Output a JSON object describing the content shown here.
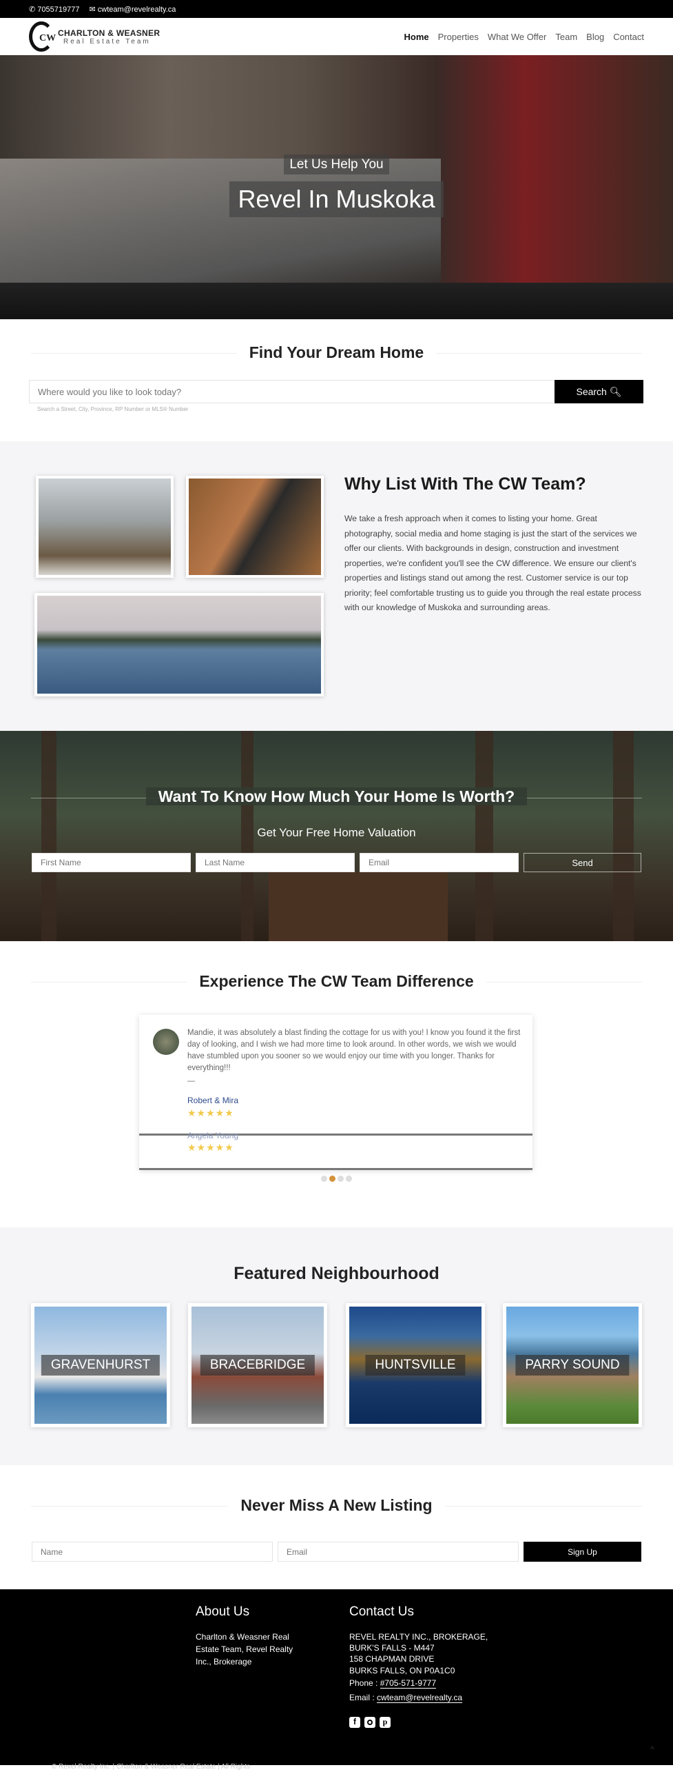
{
  "topbar": {
    "phone": "7055719777",
    "email": "cwteam@revelrealty.ca",
    "phone_icon": "phone-icon",
    "email_icon": "envelope-icon"
  },
  "nav": {
    "logo": {
      "mark": "CW",
      "name": "CHARLTON & WEASNER",
      "tagline": "Real Estate Team"
    },
    "items": [
      {
        "label": "Home"
      },
      {
        "label": "Properties"
      },
      {
        "label": "What We Offer"
      },
      {
        "label": "Team"
      },
      {
        "label": "Blog"
      },
      {
        "label": "Contact"
      }
    ]
  },
  "hero": {
    "subtitle": "Let Us Help You",
    "title": "Revel In Muskoka"
  },
  "search": {
    "title": "Find Your Dream Home",
    "placeholder": "Where would you like to look today?",
    "button": "Search",
    "hint": "Search a Street, City, Province, RP Number or MLS® Number"
  },
  "why": {
    "title": "Why List With The CW Team?",
    "body": "We take a fresh approach when it comes to listing your home. Great photography, social media and home staging is just the start of the services we offer our clients. With backgrounds in design, construction and investment properties, we're confident you'll see the CW difference. We ensure our client's properties and listings stand out among the rest. Customer service is our top priority; feel comfortable trusting us to guide you through the real estate process with our knowledge of Muskoka and surrounding areas."
  },
  "valuation": {
    "title": "Want To Know How Much Your Home Is Worth?",
    "subtitle": "Get Your Free Home Valuation",
    "first_placeholder": "First Name",
    "last_placeholder": "Last Name",
    "email_placeholder": "Email",
    "button": "Send"
  },
  "testimonials": {
    "title": "Experience The CW Team Difference",
    "items": [
      {
        "quote": "Mandie, it was absolutely a blast finding the cottage for us with you! I know you found it the first day of looking, and I wish we had more time to look around. In other words, we wish we would have stumbled upon you sooner so we would enjoy our time with you longer. Thanks for everything!!!",
        "dash": "—",
        "author": "Robert & Mira",
        "stars": "★★★★★",
        "rating": 5
      },
      {
        "author": "Angela Young",
        "stars": "★★★★★",
        "rating": 5
      }
    ],
    "dots": 4,
    "active_dot": 2,
    "accent": "#d4923a",
    "name_color": "#2d4a8a"
  },
  "featured": {
    "title": "Featured Neighbourhood",
    "items": [
      {
        "label": "GRAVENHURST"
      },
      {
        "label": "BRACEBRIDGE"
      },
      {
        "label": "HUNTSVILLE"
      },
      {
        "label": "PARRY SOUND"
      }
    ]
  },
  "newsletter": {
    "title": "Never Miss A New Listing",
    "name_placeholder": "Name",
    "email_placeholder": "Email",
    "button": "Sign Up"
  },
  "footer": {
    "about_title": "About Us",
    "about_text": "Charlton & Weasner Real Estate Team, Revel Realty Inc., Brokerage",
    "contact_title": "Contact Us",
    "address": [
      "REVEL REALTY INC., BROKERAGE,",
      "BURK'S FALLS - M447",
      "158 CHAPMAN DRIVE",
      "BURKS FALLS, ON P0A1C0"
    ],
    "phone_label": "Phone :",
    "phone": "#705-571-9777",
    "email_label": "Email :",
    "email": "cwteam@revelrealty.ca",
    "social": [
      "facebook-icon",
      "instagram-icon",
      "pinterest-icon"
    ],
    "copyright": "© Revel Realty Inc. | Charlton & Weasner Real Estate | All Rights"
  }
}
